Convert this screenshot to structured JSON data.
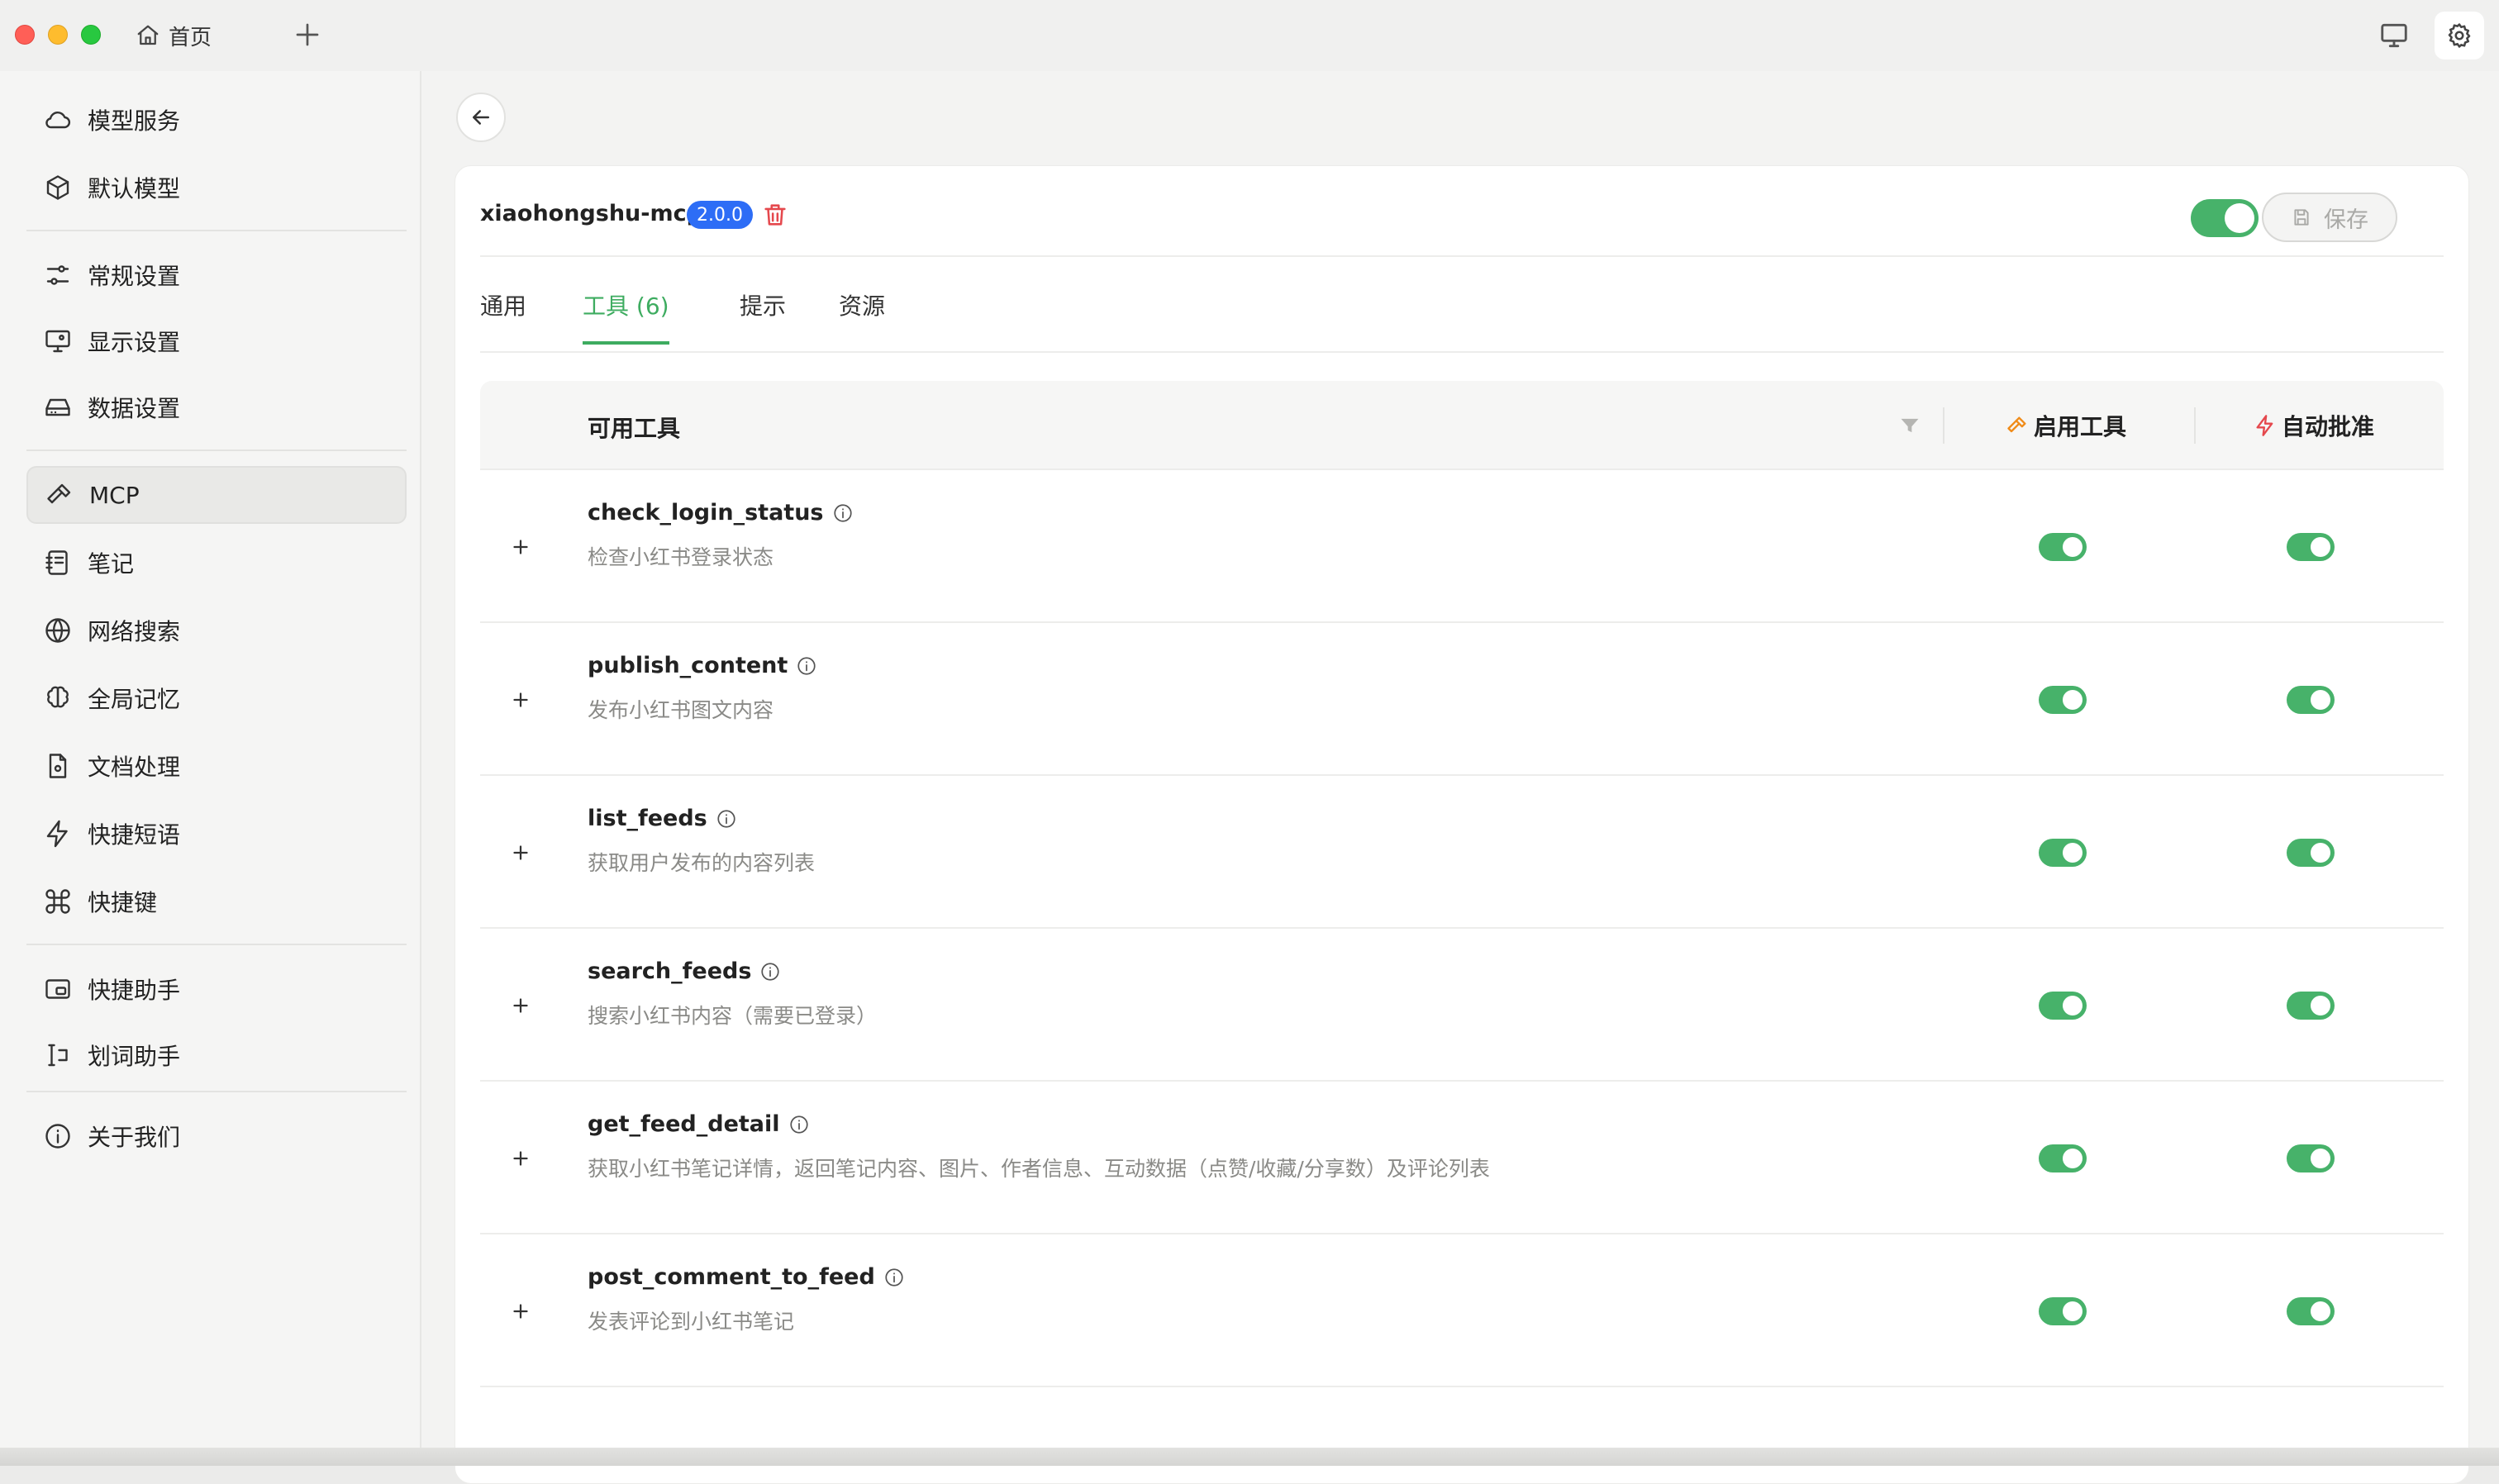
{
  "titlebar": {
    "home_tab_label": "首页"
  },
  "sidebar": {
    "items": [
      {
        "label": "模型服务",
        "icon": "cloud-icon"
      },
      {
        "label": "默认模型",
        "icon": "cube-icon"
      },
      {
        "label": "常规设置",
        "icon": "sliders-icon"
      },
      {
        "label": "显示设置",
        "icon": "monitor-settings-icon"
      },
      {
        "label": "数据设置",
        "icon": "hard-drive-icon"
      },
      {
        "label": "MCP",
        "icon": "hammer-icon"
      },
      {
        "label": "笔记",
        "icon": "notebook-icon"
      },
      {
        "label": "网络搜索",
        "icon": "globe-icon"
      },
      {
        "label": "全局记忆",
        "icon": "brain-icon"
      },
      {
        "label": "文档处理",
        "icon": "file-icon"
      },
      {
        "label": "快捷短语",
        "icon": "zap-icon"
      },
      {
        "label": "快捷键",
        "icon": "command-icon"
      },
      {
        "label": "快捷助手",
        "icon": "app-window-icon"
      },
      {
        "label": "划词助手",
        "icon": "text-select-icon"
      },
      {
        "label": "关于我们",
        "icon": "info-icon"
      }
    ],
    "active": "MCP"
  },
  "server": {
    "name": "xiaohongshu-mcp",
    "version": "2.0.0",
    "enabled": true,
    "save_label": "保存"
  },
  "tabs": [
    {
      "label": "通用",
      "active": false
    },
    {
      "label": "工具 (6)",
      "active": true
    },
    {
      "label": "提示",
      "active": false
    },
    {
      "label": "资源",
      "active": false
    }
  ],
  "table": {
    "header_tools": "可用工具",
    "header_enable": "启用工具",
    "header_auto_approve": "自动批准",
    "rows": [
      {
        "name": "check_login_status",
        "desc": "检查小红书登录状态",
        "enabled": true,
        "auto_approve": true
      },
      {
        "name": "publish_content",
        "desc": "发布小红书图文内容",
        "enabled": true,
        "auto_approve": true
      },
      {
        "name": "list_feeds",
        "desc": "获取用户发布的内容列表",
        "enabled": true,
        "auto_approve": true
      },
      {
        "name": "search_feeds",
        "desc": "搜索小红书内容（需要已登录）",
        "enabled": true,
        "auto_approve": true
      },
      {
        "name": "get_feed_detail",
        "desc": "获取小红书笔记详情，返回笔记内容、图片、作者信息、互动数据（点赞/收藏/分享数）及评论列表",
        "enabled": true,
        "auto_approve": true
      },
      {
        "name": "post_comment_to_feed",
        "desc": "发表评论到小红书笔记",
        "enabled": true,
        "auto_approve": true
      }
    ]
  },
  "colors": {
    "accent_green": "#3eac60",
    "toggle_green": "#47b26a",
    "version_badge_blue": "#2d6df6",
    "delete_red": "#e5484d",
    "enable_icon_orange": "#f08c1a",
    "auto_approve_icon_red": "#e5484d"
  }
}
